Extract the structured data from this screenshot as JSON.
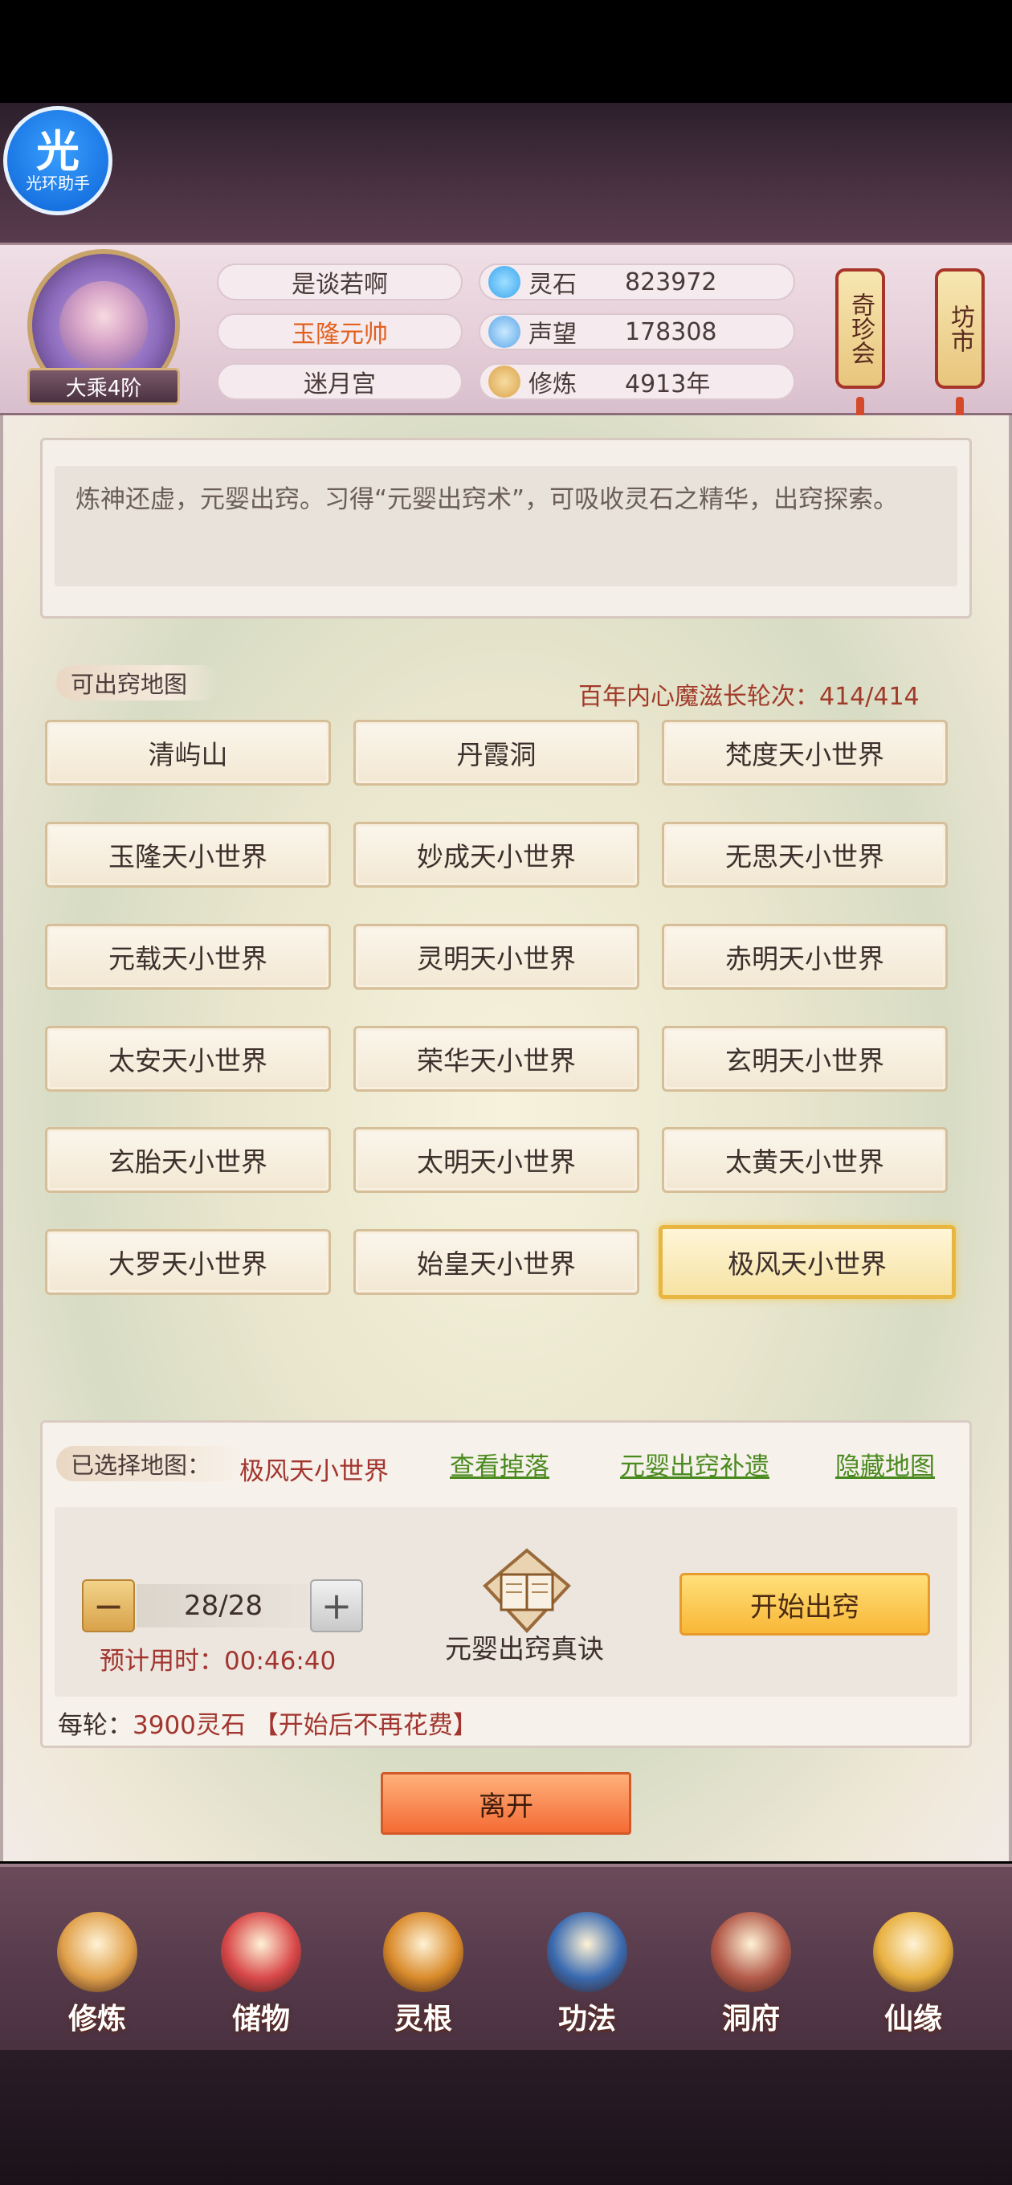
{
  "assistant": {
    "label_big": "光",
    "label_small": "光环助手"
  },
  "profile": {
    "rank": "大乘4阶",
    "name": "是谈若啊",
    "title": "玉隆元帅",
    "sect": "迷月宫"
  },
  "resources": [
    {
      "icon": "spirit-stone-icon",
      "label": "灵石",
      "value": "823972",
      "color": "#3aa4f0"
    },
    {
      "icon": "reputation-icon",
      "label": "声望",
      "value": "178308",
      "color": "#5aa6e8"
    },
    {
      "icon": "cultivation-icon",
      "label": "修炼",
      "value": "4913年",
      "color": "#d9a24a"
    }
  ],
  "hanging_buttons": [
    {
      "label": "奇珍会"
    },
    {
      "label": "坊市"
    }
  ],
  "description": "炼神还虚，元婴出窍。习得“元婴出窍术”，可吸收灵石之精华，出窍探索。",
  "maps_section": {
    "label": "可出窍地图",
    "quota": "百年内心魔滋长轮次：414/414",
    "maps": [
      "清屿山",
      "丹霞洞",
      "梵度天小世界",
      "玉隆天小世界",
      "妙成天小世界",
      "无思天小世界",
      "元载天小世界",
      "灵明天小世界",
      "赤明天小世界",
      "太安天小世界",
      "荣华天小世界",
      "玄明天小世界",
      "玄胎天小世界",
      "太明天小世界",
      "太黄天小世界",
      "大罗天小世界",
      "始皇天小世界",
      "极风天小世界"
    ],
    "selected_index": 17
  },
  "selection": {
    "label": "已选择地图：",
    "map_name": "极风天小世界",
    "links": [
      "查看掉落",
      "元婴出窍补遗",
      "隐藏地图"
    ],
    "minus": "−",
    "plus": "+",
    "count": "28/28",
    "eta": "预计用时：00:46:40",
    "book_label": "元婴出窍真诀",
    "start_button": "开始出窍",
    "cost_prefix": "每轮：",
    "cost_amount": "3900灵石",
    "cost_note": "【开始后不再花费】"
  },
  "leave_button": "离开",
  "bottom_nav": [
    {
      "label": "修炼",
      "icon": "monk-icon",
      "color": "#e0a04a"
    },
    {
      "label": "储物",
      "icon": "bag-icon",
      "color": "#d9484a"
    },
    {
      "label": "灵根",
      "icon": "spirit-root-icon",
      "color": "#d98a2a"
    },
    {
      "label": "功法",
      "icon": "book-icon",
      "color": "#3a6ab0"
    },
    {
      "label": "洞府",
      "icon": "pavilion-icon",
      "color": "#b35a4a"
    },
    {
      "label": "仙缘",
      "icon": "gourd-icon",
      "color": "#e8b040"
    }
  ]
}
